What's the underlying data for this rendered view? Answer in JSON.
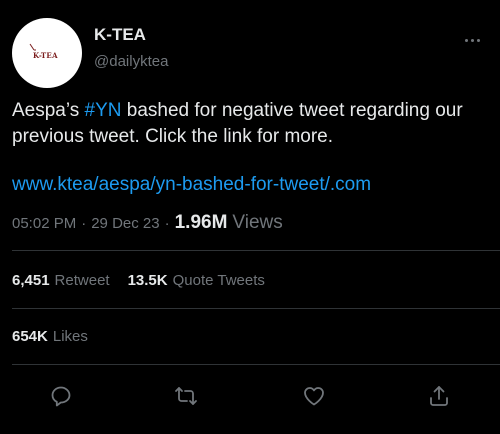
{
  "author": {
    "display_name": "K-TEA",
    "handle": "@dailyktea",
    "avatar_logo_text": "K-TEA"
  },
  "tweet": {
    "text_before_hashtag": "Aespa’s ",
    "hashtag": "#YN",
    "text_after_hashtag": " bashed for negative tweet regarding our previous tweet. Click the link for more.",
    "link": "www.ktea/aespa/yn-bashed-for-tweet/.com"
  },
  "meta": {
    "time": "05:02 PM",
    "separator": "·",
    "date": "29 Dec 23",
    "views_count": "1.96M",
    "views_label": "Views"
  },
  "stats": {
    "retweets_count": "6,451",
    "retweets_label": "Retweet",
    "quotes_count": "13.5K",
    "quotes_label": "Quote Tweets",
    "likes_count": "654K",
    "likes_label": "Likes"
  },
  "actions": {
    "reply_icon": "reply-icon",
    "retweet_icon": "retweet-icon",
    "like_icon": "heart-icon",
    "share_icon": "share-icon"
  },
  "colors": {
    "background": "#000000",
    "text_primary": "#e7e9ea",
    "text_secondary": "#71767b",
    "accent": "#1d9bf0",
    "divider": "#2f3336"
  }
}
